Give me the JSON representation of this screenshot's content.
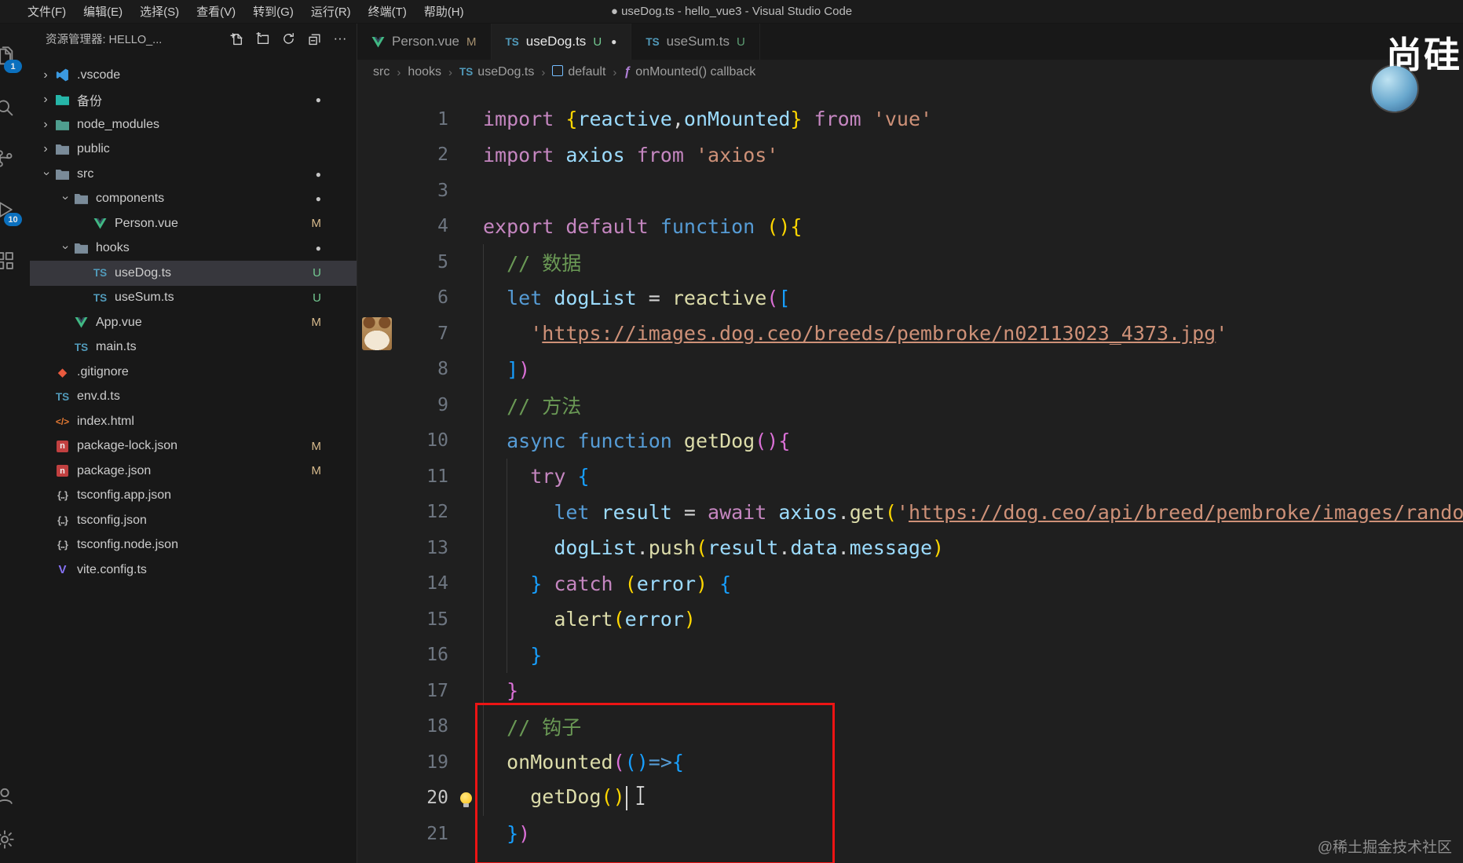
{
  "titlebar": {
    "menus": [
      "文件(F)",
      "编辑(E)",
      "选择(S)",
      "查看(V)",
      "转到(G)",
      "运行(R)",
      "终端(T)",
      "帮助(H)"
    ],
    "title": "● useDog.ts - hello_vue3 - Visual Studio Code"
  },
  "activity_bar": {
    "icons": [
      {
        "name": "explorer-icon",
        "badge": "1"
      },
      {
        "name": "search-icon",
        "badge": ""
      },
      {
        "name": "source-control-icon",
        "badge": ""
      },
      {
        "name": "run-and-debug-icon",
        "badge": "10"
      },
      {
        "name": "extensions-icon",
        "badge": ""
      }
    ],
    "bottom_icons": [
      {
        "name": "account-icon"
      },
      {
        "name": "settings-gear-icon"
      }
    ]
  },
  "sidebar": {
    "header": {
      "title": "资源管理器: HELLO_...",
      "actions": [
        "new-file-icon",
        "new-folder-icon",
        "refresh-icon",
        "collapse-all-icon"
      ],
      "more": "···"
    },
    "tree": [
      {
        "label": ".vscode",
        "depth": 0,
        "type": "folder",
        "expanded": false,
        "icon": "vscode",
        "color": "#3b99e0",
        "badge": "",
        "dot": false,
        "selected": false
      },
      {
        "label": "备份",
        "depth": 0,
        "type": "folder",
        "expanded": false,
        "icon": "folder",
        "color": "#26b5a8",
        "badge": "",
        "dot": true,
        "selected": false
      },
      {
        "label": "node_modules",
        "depth": 0,
        "type": "folder",
        "expanded": false,
        "icon": "folder",
        "color": "#4f9e8f",
        "badge": "",
        "dot": false,
        "selected": false
      },
      {
        "label": "public",
        "depth": 0,
        "type": "folder",
        "expanded": false,
        "icon": "folder",
        "color": "#7a8b99",
        "badge": "",
        "dot": false,
        "selected": false
      },
      {
        "label": "src",
        "depth": 0,
        "type": "folder",
        "expanded": true,
        "icon": "folder",
        "color": "#7a8b99",
        "badge": "",
        "dot": true,
        "selected": false
      },
      {
        "label": "components",
        "depth": 1,
        "type": "folder",
        "expanded": true,
        "icon": "folder",
        "color": "#7a8b99",
        "badge": "",
        "dot": true,
        "selected": false
      },
      {
        "label": "Person.vue",
        "depth": 2,
        "type": "file",
        "icon": "vue",
        "badge": "M",
        "dot": false,
        "selected": false
      },
      {
        "label": "hooks",
        "depth": 1,
        "type": "folder",
        "expanded": true,
        "icon": "folder",
        "color": "#7a8b99",
        "badge": "",
        "dot": true,
        "selected": false
      },
      {
        "label": "useDog.ts",
        "depth": 2,
        "type": "file",
        "icon": "ts",
        "badge": "U",
        "dot": false,
        "selected": true
      },
      {
        "label": "useSum.ts",
        "depth": 2,
        "type": "file",
        "icon": "ts",
        "badge": "U",
        "dot": false,
        "selected": false
      },
      {
        "label": "App.vue",
        "depth": 1,
        "type": "file",
        "icon": "vue",
        "badge": "M",
        "dot": false,
        "selected": false
      },
      {
        "label": "main.ts",
        "depth": 1,
        "type": "file",
        "icon": "ts",
        "badge": "",
        "dot": false,
        "selected": false
      },
      {
        "label": ".gitignore",
        "depth": 0,
        "type": "file",
        "icon": "git",
        "badge": "",
        "dot": false,
        "selected": false
      },
      {
        "label": "env.d.ts",
        "depth": 0,
        "type": "file",
        "icon": "ts",
        "badge": "",
        "dot": false,
        "selected": false
      },
      {
        "label": "index.html",
        "depth": 0,
        "type": "file",
        "icon": "html",
        "badge": "",
        "dot": false,
        "selected": false
      },
      {
        "label": "package-lock.json",
        "depth": 0,
        "type": "file",
        "icon": "npm",
        "badge": "M",
        "dot": false,
        "selected": false
      },
      {
        "label": "package.json",
        "depth": 0,
        "type": "file",
        "icon": "npm",
        "badge": "M",
        "dot": false,
        "selected": false
      },
      {
        "label": "tsconfig.app.json",
        "depth": 0,
        "type": "file",
        "icon": "json",
        "badge": "",
        "dot": false,
        "selected": false
      },
      {
        "label": "tsconfig.json",
        "depth": 0,
        "type": "file",
        "icon": "json",
        "badge": "",
        "dot": false,
        "selected": false
      },
      {
        "label": "tsconfig.node.json",
        "depth": 0,
        "type": "file",
        "icon": "json",
        "badge": "",
        "dot": false,
        "selected": false
      },
      {
        "label": "vite.config.ts",
        "depth": 0,
        "type": "file",
        "icon": "vite",
        "badge": "",
        "dot": false,
        "selected": false
      }
    ]
  },
  "tabs": [
    {
      "label": "Person.vue",
      "icon": "vue",
      "badge": "M",
      "dirty": false,
      "active": false
    },
    {
      "label": "useDog.ts",
      "icon": "ts",
      "badge": "U",
      "dirty": true,
      "active": true
    },
    {
      "label": "useSum.ts",
      "icon": "ts",
      "badge": "U",
      "dirty": false,
      "active": false
    }
  ],
  "breadcrumb": [
    {
      "label": "src",
      "icon": ""
    },
    {
      "label": "hooks",
      "icon": ""
    },
    {
      "label": "useDog.ts",
      "icon": "ts"
    },
    {
      "label": "default",
      "icon": "sym-box"
    },
    {
      "label": "onMounted() callback",
      "icon": "sym-fn"
    }
  ],
  "code": {
    "dog_thumb_line": 7,
    "lightbulb_line": 20,
    "caret_line": 20,
    "red_box_lines": [
      18,
      21
    ],
    "lines": [
      {
        "n": 1,
        "tokens": [
          [
            "import",
            "kw"
          ],
          [
            " ",
            "fg"
          ],
          [
            "{",
            "b1"
          ],
          [
            "reactive",
            "var"
          ],
          [
            ",",
            "fg"
          ],
          [
            "onMounted",
            "var"
          ],
          [
            "}",
            "b1"
          ],
          [
            " ",
            "fg"
          ],
          [
            "from",
            "kw"
          ],
          [
            " ",
            "fg"
          ],
          [
            "'vue'",
            "str"
          ]
        ]
      },
      {
        "n": 2,
        "tokens": [
          [
            "import",
            "kw"
          ],
          [
            " ",
            "fg"
          ],
          [
            "axios",
            "var"
          ],
          [
            " ",
            "fg"
          ],
          [
            "from",
            "kw"
          ],
          [
            " ",
            "fg"
          ],
          [
            "'axios'",
            "str"
          ]
        ]
      },
      {
        "n": 3,
        "tokens": []
      },
      {
        "n": 4,
        "tokens": [
          [
            "export",
            "kw"
          ],
          [
            " ",
            "fg"
          ],
          [
            "default",
            "kw"
          ],
          [
            " ",
            "fg"
          ],
          [
            "function",
            "kw2"
          ],
          [
            " ",
            "fg"
          ],
          [
            "(",
            "b1"
          ],
          [
            ")",
            "b1"
          ],
          [
            "{",
            "b1"
          ]
        ]
      },
      {
        "n": 5,
        "tokens": [
          [
            "  ",
            "fg"
          ],
          [
            "// 数据",
            "com"
          ]
        ]
      },
      {
        "n": 6,
        "tokens": [
          [
            "  ",
            "fg"
          ],
          [
            "let",
            "kw2"
          ],
          [
            " ",
            "fg"
          ],
          [
            "dogList",
            "var"
          ],
          [
            " ",
            "fg"
          ],
          [
            "=",
            "fg"
          ],
          [
            " ",
            "fg"
          ],
          [
            "reactive",
            "fn"
          ],
          [
            "(",
            "b2"
          ],
          [
            "[",
            "b3"
          ]
        ]
      },
      {
        "n": 7,
        "tokens": [
          [
            "    ",
            "fg"
          ],
          [
            "'",
            "str"
          ],
          [
            "https://images.dog.ceo/breeds/pembroke/n02113023_4373.jpg",
            "stru"
          ],
          [
            "'",
            "str"
          ]
        ]
      },
      {
        "n": 8,
        "tokens": [
          [
            "  ",
            "fg"
          ],
          [
            "]",
            "b3"
          ],
          [
            ")",
            "b2"
          ]
        ]
      },
      {
        "n": 9,
        "tokens": [
          [
            "  ",
            "fg"
          ],
          [
            "// 方法",
            "com"
          ]
        ]
      },
      {
        "n": 10,
        "tokens": [
          [
            "  ",
            "fg"
          ],
          [
            "async",
            "kw2"
          ],
          [
            " ",
            "fg"
          ],
          [
            "function",
            "kw2"
          ],
          [
            " ",
            "fg"
          ],
          [
            "getDog",
            "fn"
          ],
          [
            "(",
            "b2"
          ],
          [
            ")",
            "b2"
          ],
          [
            "{",
            "b2"
          ]
        ]
      },
      {
        "n": 11,
        "tokens": [
          [
            "    ",
            "fg"
          ],
          [
            "try",
            "kw"
          ],
          [
            " ",
            "fg"
          ],
          [
            "{",
            "b3"
          ]
        ]
      },
      {
        "n": 12,
        "tokens": [
          [
            "      ",
            "fg"
          ],
          [
            "let",
            "kw2"
          ],
          [
            " ",
            "fg"
          ],
          [
            "result",
            "var"
          ],
          [
            " ",
            "fg"
          ],
          [
            "=",
            "fg"
          ],
          [
            " ",
            "fg"
          ],
          [
            "await",
            "kw"
          ],
          [
            " ",
            "fg"
          ],
          [
            "axios",
            "var"
          ],
          [
            ".",
            "fg"
          ],
          [
            "get",
            "fn"
          ],
          [
            "(",
            "b1"
          ],
          [
            "'",
            "str"
          ],
          [
            "https://dog.ceo/api/breed/pembroke/images/random",
            "stru"
          ],
          [
            "'",
            "str"
          ],
          [
            ")",
            "b1"
          ]
        ]
      },
      {
        "n": 13,
        "tokens": [
          [
            "      ",
            "fg"
          ],
          [
            "dogList",
            "var"
          ],
          [
            ".",
            "fg"
          ],
          [
            "push",
            "fn"
          ],
          [
            "(",
            "b1"
          ],
          [
            "result",
            "var"
          ],
          [
            ".",
            "fg"
          ],
          [
            "data",
            "var"
          ],
          [
            ".",
            "fg"
          ],
          [
            "message",
            "var"
          ],
          [
            ")",
            "b1"
          ]
        ]
      },
      {
        "n": 14,
        "tokens": [
          [
            "    ",
            "fg"
          ],
          [
            "}",
            "b3"
          ],
          [
            " ",
            "fg"
          ],
          [
            "catch",
            "kw"
          ],
          [
            " ",
            "fg"
          ],
          [
            "(",
            "b1"
          ],
          [
            "error",
            "var"
          ],
          [
            ")",
            "b1"
          ],
          [
            " ",
            "fg"
          ],
          [
            "{",
            "b3"
          ]
        ]
      },
      {
        "n": 15,
        "tokens": [
          [
            "      ",
            "fg"
          ],
          [
            "alert",
            "fn"
          ],
          [
            "(",
            "b1"
          ],
          [
            "error",
            "var"
          ],
          [
            ")",
            "b1"
          ]
        ]
      },
      {
        "n": 16,
        "tokens": [
          [
            "    ",
            "fg"
          ],
          [
            "}",
            "b3"
          ]
        ]
      },
      {
        "n": 17,
        "tokens": [
          [
            "  ",
            "fg"
          ],
          [
            "}",
            "b2"
          ]
        ]
      },
      {
        "n": 18,
        "tokens": [
          [
            "  ",
            "fg"
          ],
          [
            "// 钩子",
            "com"
          ]
        ]
      },
      {
        "n": 19,
        "tokens": [
          [
            "  ",
            "fg"
          ],
          [
            "onMounted",
            "fn"
          ],
          [
            "(",
            "b2"
          ],
          [
            "(",
            "b3"
          ],
          [
            ")",
            "b3"
          ],
          [
            "=>",
            "kw2"
          ],
          [
            "{",
            "b3"
          ]
        ]
      },
      {
        "n": 20,
        "tokens": [
          [
            "    ",
            "fg"
          ],
          [
            "getDog",
            "fn"
          ],
          [
            "(",
            "b1"
          ],
          [
            ")",
            "b1"
          ]
        ]
      },
      {
        "n": 21,
        "tokens": [
          [
            "  ",
            "fg"
          ],
          [
            "}",
            "b3"
          ],
          [
            ")",
            "b2"
          ]
        ]
      }
    ]
  },
  "watermarks": {
    "logo": "尚硅",
    "community": "@稀土掘金技术社区"
  },
  "colors": {
    "editor_background": "#1f1f1f",
    "sidebar_background": "#181818",
    "badge_accent": "#0a7ad1",
    "selected_row": "#37373d",
    "git_modified": "#d7ba8d",
    "git_untracked": "#73c991",
    "annotation_red": "#ec1414",
    "keyword": "#C586C0",
    "keyword_storage": "#569CD6",
    "function_name": "#DCDCAA",
    "variable": "#9CDCFE",
    "string": "#CE9178",
    "comment": "#6A9955",
    "bracket_level1": "#FFD700",
    "bracket_level2": "#DA70D6",
    "bracket_level3": "#179FFF",
    "foreground": "#D4D4D4"
  }
}
